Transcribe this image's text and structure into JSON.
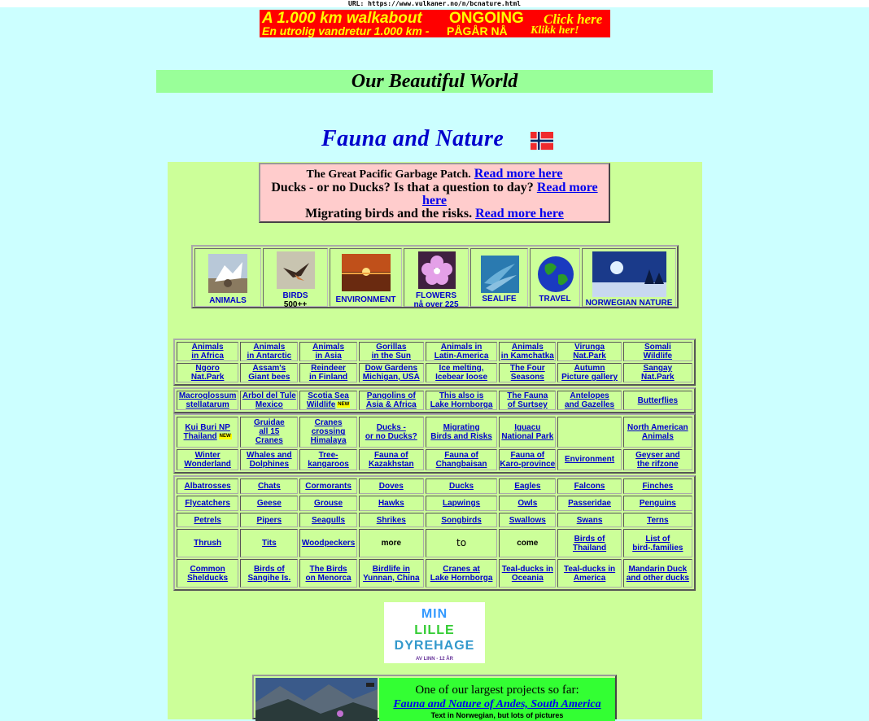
{
  "url_bar": "URL: https://www.vulkaner.no/n/bcnature.html",
  "banner": {
    "line1_a": "A 1.000 km walkabout",
    "line1_b": "ONGOING",
    "line1_c": "Click here",
    "line2_a": "En utrolig vandretur 1.000 km -",
    "line2_b": "PÅGÅR NÅ",
    "line2_c": "Klikk her!"
  },
  "header": {
    "section_title": "Our Beautiful World",
    "page_title": "Fauna and Nature"
  },
  "news": {
    "item1_text": "The Great Pacific Garbage Patch.",
    "item2_text": "Ducks - or no Ducks? Is that a question to day?",
    "item3_text": "Migrating birds and the risks.",
    "read_more": "Read more here"
  },
  "categories": [
    {
      "line1": "ANIMALS",
      "line2": ""
    },
    {
      "line1": "BIRDS",
      "line2": "500++"
    },
    {
      "line1": "ENVIRONMENT",
      "line2": ""
    },
    {
      "line1": "FLOWERS",
      "line2": "nå over 225"
    },
    {
      "line1": "SEALIFE",
      "line2": ""
    },
    {
      "line1": "TRAVEL",
      "line2": ""
    },
    {
      "line1": "NORWEGIAN NATURE",
      "line2": ""
    }
  ],
  "new_badge": "NEW",
  "table1": [
    [
      [
        "Animals",
        "in Africa"
      ],
      [
        "Animals",
        "in Antarctic"
      ],
      [
        "Animals",
        "in Asia"
      ],
      [
        "Gorillas",
        "in the Sun"
      ],
      [
        "Animals in",
        "Latin-America"
      ],
      [
        "Animals",
        "in Kamchatka"
      ],
      [
        "Virunga",
        "Nat.Park"
      ],
      [
        "Somali",
        "Wildlife"
      ]
    ],
    [
      [
        "Ngoro",
        "Nat.Park"
      ],
      [
        "Assam's",
        "Giant bees"
      ],
      [
        "Reindeer",
        "in Finland"
      ],
      [
        "Dow Gardens",
        "Michigan, USA"
      ],
      [
        "Ice melting,",
        "Icebear loose"
      ],
      [
        "The Four",
        "Seasons"
      ],
      [
        "Autumn",
        "Picture gallery"
      ],
      [
        "Sangay",
        "Nat.Park"
      ]
    ]
  ],
  "table2": [
    [
      [
        "Macroglossum",
        "stellatarum"
      ],
      [
        "Arbol del Tule",
        "Mexico"
      ],
      [
        "Scotia Sea",
        "Wildlife"
      ],
      [
        "Pangolins of",
        "Asia & Africa"
      ],
      [
        "This also is",
        "Lake Hornborga"
      ],
      [
        "The Fauna",
        "of Surtsey"
      ],
      [
        "Antelopes",
        "and Gazelles"
      ],
      [
        "Butterflies",
        ""
      ]
    ]
  ],
  "table3": [
    [
      [
        "Kui Buri NP",
        "Thailand",
        ""
      ],
      [
        "Gruidae",
        "all 15",
        "Cranes"
      ],
      [
        "Cranes",
        "crossing",
        "Himalaya"
      ],
      [
        "Ducks -",
        "or no Ducks?",
        ""
      ],
      [
        "Migrating",
        "Birds and Risks",
        ""
      ],
      [
        "Iguacu",
        "National Park",
        ""
      ],
      [
        "",
        "",
        ""
      ],
      [
        "North American",
        "Animals",
        ""
      ]
    ],
    [
      [
        "Winter",
        "Wonderland",
        ""
      ],
      [
        "Whales and",
        "Dolphines",
        ""
      ],
      [
        "Tree-",
        "kangaroos",
        ""
      ],
      [
        "Fauna of",
        "Kazakhstan",
        ""
      ],
      [
        "Fauna of",
        "Changbaisan",
        ""
      ],
      [
        "Fauna of",
        "Karo-province",
        ""
      ],
      [
        "Environment",
        "",
        ""
      ],
      [
        "Geyser and",
        "the rifzone",
        ""
      ]
    ]
  ],
  "table4": [
    [
      [
        "Albatrosses"
      ],
      [
        "Chats"
      ],
      [
        "Cormorants"
      ],
      [
        "Doves"
      ],
      [
        "Ducks"
      ],
      [
        "Eagles"
      ],
      [
        "Falcons"
      ],
      [
        "Finches"
      ]
    ],
    [
      [
        "Flycatchers"
      ],
      [
        "Geese"
      ],
      [
        "Grouse"
      ],
      [
        "Hawks"
      ],
      [
        "Lapwings"
      ],
      [
        "Owls"
      ],
      [
        "Passeridae"
      ],
      [
        "Penguins"
      ]
    ],
    [
      [
        "Petrels"
      ],
      [
        "Pipers"
      ],
      [
        "Seagulls"
      ],
      [
        "Shrikes"
      ],
      [
        "Songbirds"
      ],
      [
        "Swallows"
      ],
      [
        "Swans"
      ],
      [
        "Terns"
      ]
    ],
    [
      [
        "Thrush"
      ],
      [
        "Tits"
      ],
      [
        "Woodpeckers"
      ],
      [
        "more"
      ],
      [
        "to"
      ],
      [
        "come"
      ],
      [
        "Birds of",
        "Thailand"
      ],
      [
        "List of",
        "bird-.families"
      ]
    ],
    [
      [
        "Common",
        "Shelducks"
      ],
      [
        "Birds of",
        "Sangihe Is."
      ],
      [
        "The Birds",
        "on Menorca"
      ],
      [
        "Birdlife in",
        "Yunnan, China"
      ],
      [
        "Cranes at",
        "Lake Hornborga"
      ],
      [
        "Teal-ducks in",
        "Oceania"
      ],
      [
        "Teal-ducks in",
        "America"
      ],
      [
        "Mandarin Duck",
        "and other ducks"
      ]
    ]
  ],
  "dyrehage": {
    "line1": "MIN",
    "line2": "LILLE",
    "line3": "DYREHAGE",
    "sub": "AV LINN - 12 ÅR"
  },
  "andes": {
    "line1": "One of our largest projects so far:",
    "line2": "Fauna and Nature of Andes, South America",
    "line3": "Text in Norwegian, but lots of pictures"
  },
  "colors": {
    "page_bg": "#ccffff",
    "content_bg": "#ccff99",
    "title_band": "#99ff99",
    "link": "#0000cc",
    "banner_bg": "#ff0000",
    "banner_text": "#ffff00"
  }
}
